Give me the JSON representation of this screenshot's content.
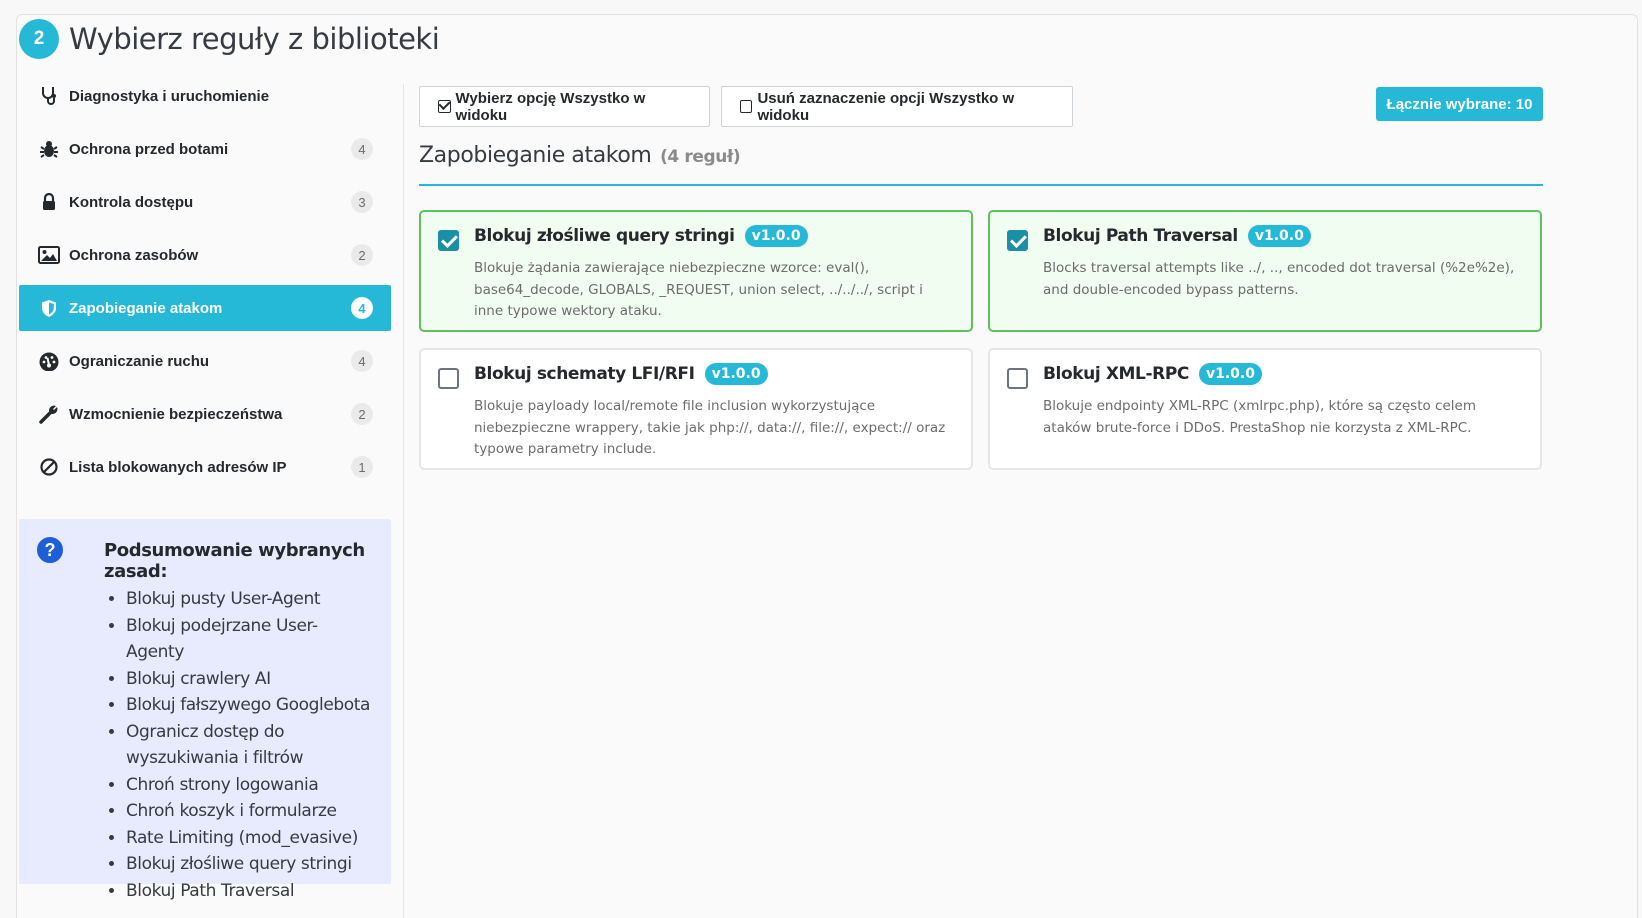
{
  "step": {
    "number": "2",
    "title": "Wybierz reguły z biblioteki"
  },
  "sidebar": {
    "items": [
      {
        "label": "Diagnostyka i uruchomienie",
        "icon": "stethoscope-icon",
        "count": ""
      },
      {
        "label": "Ochrona przed botami",
        "icon": "bug-icon",
        "count": "4"
      },
      {
        "label": "Kontrola dostępu",
        "icon": "lock-icon",
        "count": "3"
      },
      {
        "label": "Ochrona zasobów",
        "icon": "image-icon",
        "count": "2"
      },
      {
        "label": "Zapobieganie atakom",
        "icon": "shield-icon",
        "count": "4",
        "active": true
      },
      {
        "label": "Ograniczanie ruchu",
        "icon": "gauge-icon",
        "count": "4"
      },
      {
        "label": "Wzmocnienie bezpieczeństwa",
        "icon": "wrench-icon",
        "count": "2"
      },
      {
        "label": "Lista blokowanych adresów IP",
        "icon": "ban-icon",
        "count": "1"
      }
    ]
  },
  "summary": {
    "title": "Podsumowanie wybranych zasad:",
    "items": [
      "Blokuj pusty User-Agent",
      "Blokuj podejrzane User-Agenty",
      "Blokuj crawlery AI",
      "Blokuj fałszywego Googlebota",
      "Ogranicz dostęp do wyszukiwania i filtrów",
      "Chroń strony logowania",
      "Chroń koszyk i formularze",
      "Rate Limiting (mod_evasive)",
      "Blokuj złośliwe query stringi",
      "Blokuj Path Traversal"
    ]
  },
  "toolbar": {
    "select_all_label": "Wybierz opcję Wszystko w widoku",
    "deselect_all_label": "Usuń zaznaczenie opcji Wszystko w widoku",
    "total_label": "Łącznie wybrane:",
    "total_value": "10"
  },
  "section": {
    "title": "Zapobieganie atakom",
    "count": "(4 reguł)"
  },
  "rules": [
    {
      "title": "Blokuj złośliwe query stringi",
      "version": "v1.0.0",
      "checked": true,
      "description": "Blokuje żądania zawierające niebezpieczne wzorce: eval(), base64_decode, GLOBALS, _REQUEST, union select, ../../../, script i inne typowe wektory ataku."
    },
    {
      "title": "Blokuj Path Traversal",
      "version": "v1.0.0",
      "checked": true,
      "description": "Blocks traversal attempts like ../, .., encoded dot traversal (%2e%2e), and double-encoded bypass patterns."
    },
    {
      "title": "Blokuj schematy LFI/RFI",
      "version": "v1.0.0",
      "checked": false,
      "description": "Blokuje payloady local/remote file inclusion wykorzystujące niebezpieczne wrappery, takie jak php://, data://, file://, expect:// oraz typowe parametry include."
    },
    {
      "title": "Blokuj XML-RPC",
      "version": "v1.0.0",
      "checked": false,
      "description": "Blokuje endpointy XML-RPC (xmlrpc.php), które są często celem ataków brute-force i DDoS. PrestaShop nie korzysta z XML-RPC."
    }
  ],
  "colors": {
    "accent": "#25b9d7",
    "checked_border": "#5ec15e",
    "checked_bg": "#f0fdf0",
    "summary_bg": "#e8ebfd"
  }
}
